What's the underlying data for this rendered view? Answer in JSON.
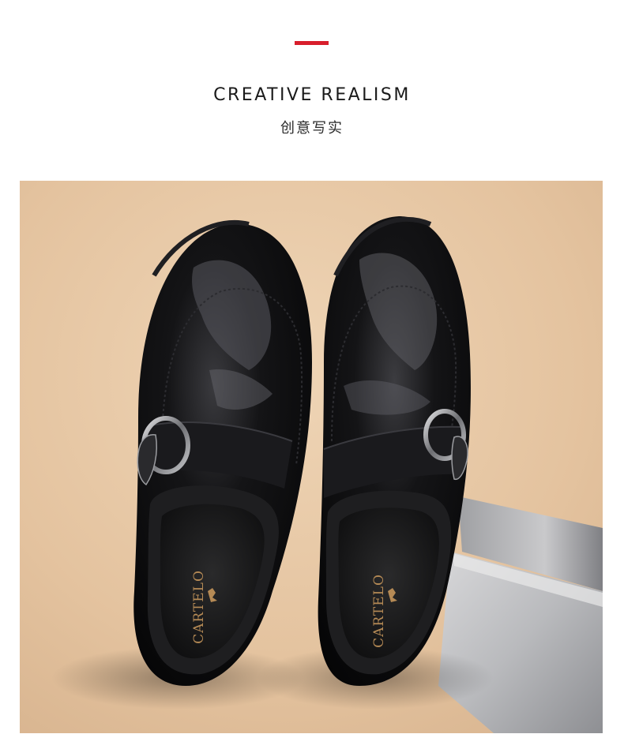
{
  "header": {
    "title": "CREATIVE REALISM",
    "subtitle": "创意写实"
  },
  "product_photo": {
    "insole_brand": "CARTELO"
  },
  "colors": {
    "accent": "#d81e2c",
    "backdrop": "#e6c8a6",
    "leather": "#0d0d0f"
  }
}
